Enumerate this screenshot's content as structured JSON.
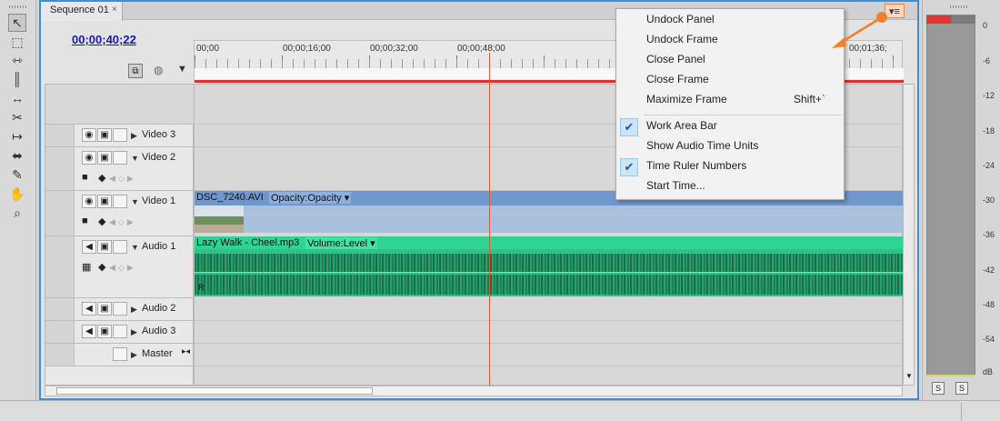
{
  "tab": {
    "title": "Sequence 01",
    "close": "×"
  },
  "timecode": "00;00;40;22",
  "ruler": {
    "labels": [
      "00;00",
      "00;00;16;00",
      "00;00;32;00",
      "00;00;48;00",
      "00;01;36;"
    ]
  },
  "tracks": {
    "video3": "Video 3",
    "video2": "Video 2",
    "video1": "Video 1",
    "audio1": "Audio 1",
    "audio2": "Audio 2",
    "audio3": "Audio 3",
    "master": "Master"
  },
  "clips": {
    "video_name": "DSC_7240.AVI",
    "video_effect": "Opacity:Opacity",
    "audio_name": "Lazy Walk - Cheel.mp3",
    "audio_effect": "Volume:Level",
    "channel_l": "L",
    "channel_r": "R"
  },
  "menu": {
    "items": [
      {
        "label": "Undock Panel",
        "checked": false
      },
      {
        "label": "Undock Frame",
        "checked": false
      },
      {
        "label": "Close Panel",
        "checked": false
      },
      {
        "label": "Close Frame",
        "checked": false
      },
      {
        "label": "Maximize Frame",
        "shortcut": "Shift+`",
        "checked": false
      },
      {
        "label": "Work Area Bar",
        "checked": true
      },
      {
        "label": "Show Audio Time Units",
        "checked": false
      },
      {
        "label": "Time Ruler Numbers",
        "checked": true
      },
      {
        "label": "Start Time...",
        "checked": false
      }
    ]
  },
  "meter": {
    "scale": [
      "0",
      "-6",
      "-12",
      "-18",
      "-24",
      "-30",
      "-36",
      "-42",
      "-48",
      "-54",
      "dB"
    ],
    "solo": "S"
  },
  "colors": {
    "accent": "#3d90d4",
    "video_clip": "#6f97cc",
    "audio_clip": "#2fd393",
    "playhead": "#e05a2a",
    "annotation": "#f07f2e"
  }
}
